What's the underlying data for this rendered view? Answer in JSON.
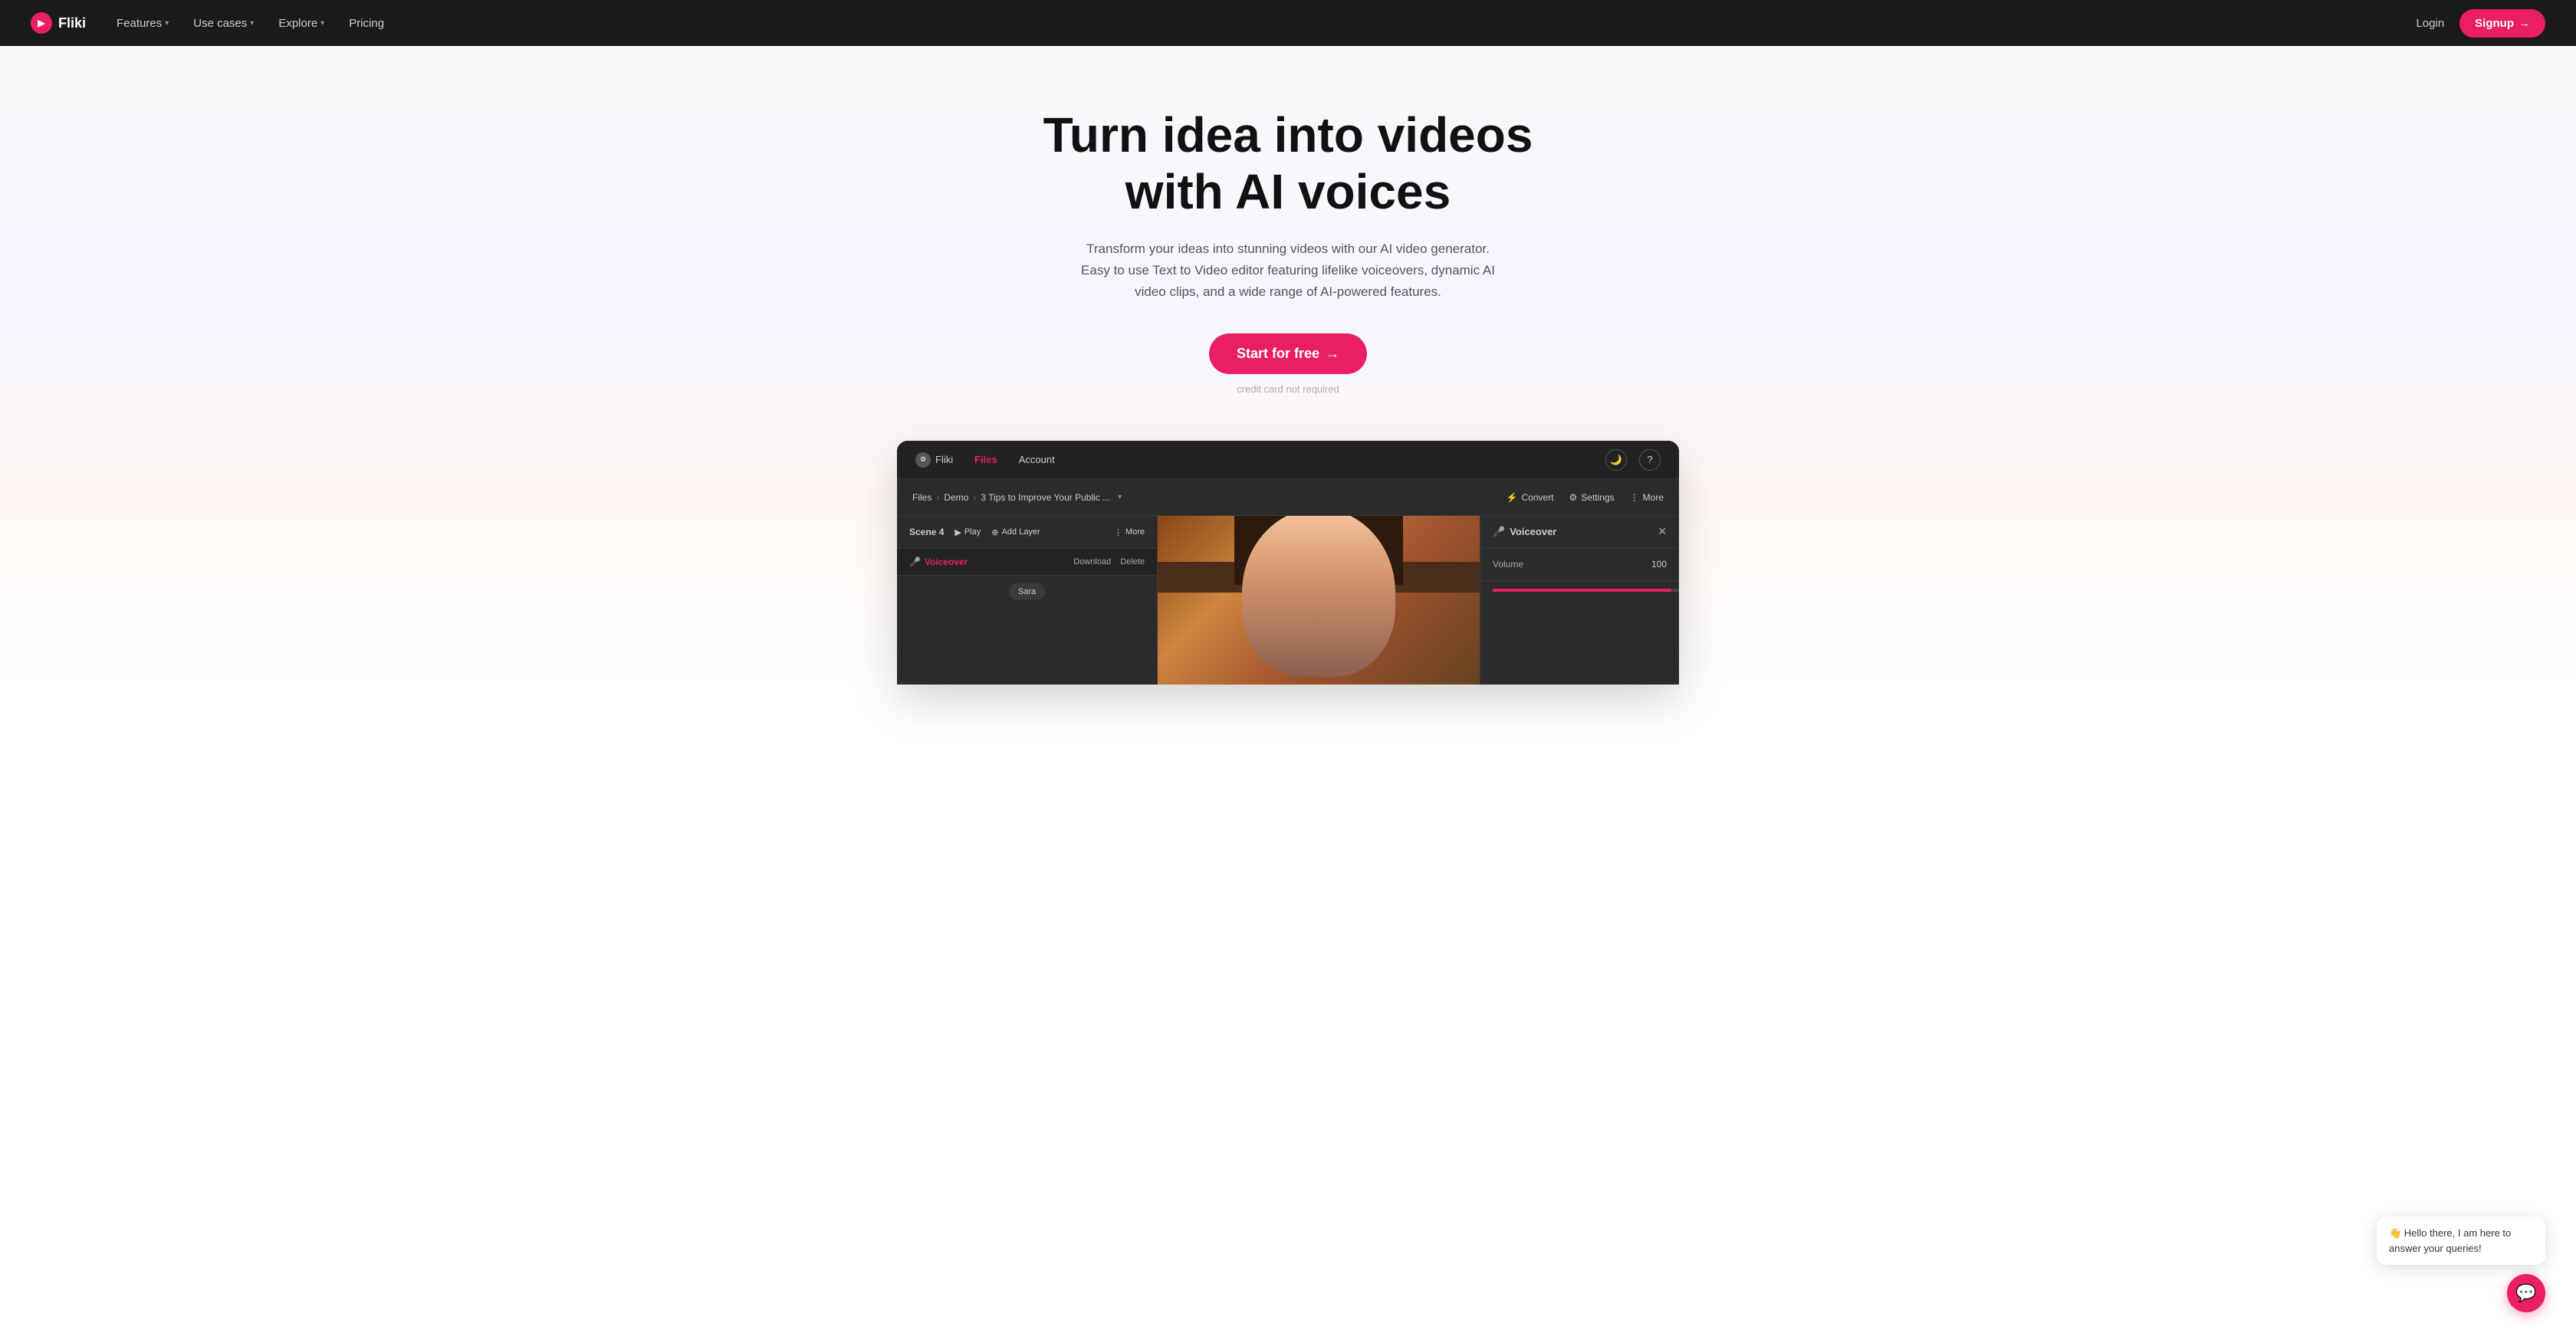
{
  "navbar": {
    "logo_text": "Fliki",
    "logo_icon": "▶",
    "nav_items": [
      {
        "label": "Features",
        "has_dropdown": true
      },
      {
        "label": "Use cases",
        "has_dropdown": true
      },
      {
        "label": "Explore",
        "has_dropdown": true
      },
      {
        "label": "Pricing",
        "has_dropdown": false
      }
    ],
    "login_label": "Login",
    "signup_label": "Signup",
    "signup_arrow": "→"
  },
  "hero": {
    "title_line1": "Turn idea into videos",
    "title_line2": "with AI voices",
    "subtitle": "Transform your ideas into stunning videos with our AI video generator. Easy to use Text to Video editor featuring lifelike voiceovers, dynamic AI video clips, and a wide range of AI-powered features.",
    "cta_label": "Start for free",
    "cta_arrow": "→",
    "note": "credit card not required"
  },
  "app": {
    "topbar": {
      "logo_icon": "⚙",
      "logo_text": "Fliki",
      "nav_files": "Files",
      "nav_account": "Account",
      "moon_icon": "🌙",
      "help_icon": "?"
    },
    "breadcrumb": {
      "path": [
        "Files",
        "Demo",
        "3 Tips to Improve Your Public ..."
      ],
      "convert_label": "Convert",
      "convert_icon": "⚡",
      "settings_label": "Settings",
      "settings_icon": "⚙",
      "more_label": "More",
      "more_icon": "⋮"
    },
    "scene": {
      "label": "Scene 4",
      "play_label": "Play",
      "add_layer_label": "Add Layer",
      "more_label": "More"
    },
    "voiceover": {
      "label": "Voiceover",
      "mic_icon": "🎤",
      "download_label": "Download",
      "delete_label": "Delete",
      "speaker_name": "Sara"
    },
    "vo_panel": {
      "title": "Voiceover",
      "mic_icon": "🎤",
      "close_icon": "✕",
      "volume_label": "Volume",
      "volume_value": "100",
      "slider_percent": 90
    }
  },
  "chat": {
    "bubble_text": "👋 Hello there, I am here to answer your queries!",
    "btn_icon": "💬"
  }
}
